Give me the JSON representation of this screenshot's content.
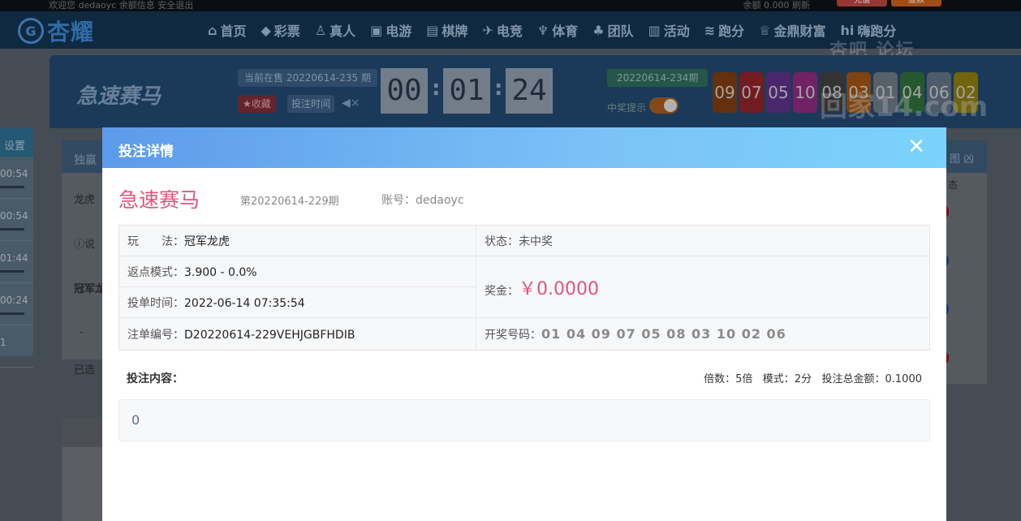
{
  "topbar": {
    "left_text": "欢迎您 dedaoyc  余额信息  安全退出",
    "right_text": "余额 0.000  刷新",
    "deposit_label": "充值",
    "withdraw_label": "提款",
    "deposit_color": "#c0392b",
    "withdraw_color": "#d35400"
  },
  "nav": {
    "logo_text": "杏耀",
    "items": [
      {
        "label": "首页",
        "icon": "home-icon",
        "glyph": "⌂"
      },
      {
        "label": "彩票",
        "icon": "lottery-icon",
        "glyph": "◆"
      },
      {
        "label": "真人",
        "icon": "live-icon",
        "glyph": "♙"
      },
      {
        "label": "电游",
        "icon": "slot-icon",
        "glyph": "▣"
      },
      {
        "label": "棋牌",
        "icon": "cards-icon",
        "glyph": "▤"
      },
      {
        "label": "电竞",
        "icon": "gamepad-icon",
        "glyph": "✈"
      },
      {
        "label": "体育",
        "icon": "trophy-icon",
        "glyph": "♆"
      },
      {
        "label": "团队",
        "icon": "team-icon",
        "glyph": "♣"
      },
      {
        "label": "活动",
        "icon": "gift-icon",
        "glyph": "▥"
      },
      {
        "label": "跑分",
        "icon": "run-icon",
        "glyph": "≋"
      },
      {
        "label": "金鼎财富",
        "icon": "wealth-icon",
        "glyph": "♕"
      },
      {
        "label": "嗨跑分",
        "icon": "hi-icon",
        "glyph": "hi"
      }
    ]
  },
  "watermark": {
    "top": "杏吧 论坛",
    "bottom": "回家14.com"
  },
  "banner": {
    "lottery_name": "急速赛马",
    "current_issue": "当前在售 20220614-235 期",
    "favorite_label": "★收藏",
    "bet_time_label": "投注时间",
    "countdown": [
      "00",
      "01",
      "24"
    ],
    "prev_issue": "20220614-234期",
    "win_notice_label": "中奖提示",
    "result_balls": [
      {
        "n": "09",
        "color": "#7a3b12"
      },
      {
        "n": "07",
        "color": "#8c2228"
      },
      {
        "n": "05",
        "color": "#5b2f86"
      },
      {
        "n": "10",
        "color": "#8a2a7a"
      },
      {
        "n": "08",
        "color": "#3f3f3f"
      },
      {
        "n": "03",
        "color": "#9a5212"
      },
      {
        "n": "01",
        "color": "#6b7780"
      },
      {
        "n": "04",
        "color": "#2f6b3a"
      },
      {
        "n": "06",
        "color": "#607080"
      },
      {
        "n": "02",
        "color": "#8a7a10"
      }
    ]
  },
  "side": {
    "header": "设置",
    "rows": [
      "00:54",
      "00:54",
      "01:44",
      "00:24",
      "1"
    ]
  },
  "background_card": {
    "tab": "独赢",
    "row1": "龙虎",
    "info": "说",
    "row3": "冠军龙",
    "dash": "-",
    "selected": "已选",
    "right_head": "图 凶",
    "right_sub": "态"
  },
  "modal": {
    "title": "投注详情",
    "close_symbol": "✕",
    "lottery_name": "急速赛马",
    "issue": "第20220614-229期",
    "account_label": "账号：",
    "account": "dedaoyc",
    "play_label": "玩　　法：",
    "play_value": "冠军龙虎",
    "status_label": "状态：",
    "status_value": "未中奖",
    "rebate_label": "返点模式：",
    "rebate_value": "3.900 - 0.0%",
    "prize_label": "奖金：",
    "prize_value": "￥0.0000",
    "time_label": "投单时间：",
    "time_value": "2022-06-14 07:35:54",
    "order_label": "注单编号：",
    "order_value": "D20220614-229VEHJGBFHDIB",
    "draw_label": "开奖号码：",
    "draw_value": "01 04 09 07 05 08 03 10 02 06",
    "content_label": "投注内容：",
    "multiple_label": "倍数：",
    "multiple_value": "5倍",
    "mode_label": "模式：",
    "mode_value": "2分",
    "total_label": "投注总金额：",
    "total_value": "0.1000",
    "bet_content": "0"
  }
}
